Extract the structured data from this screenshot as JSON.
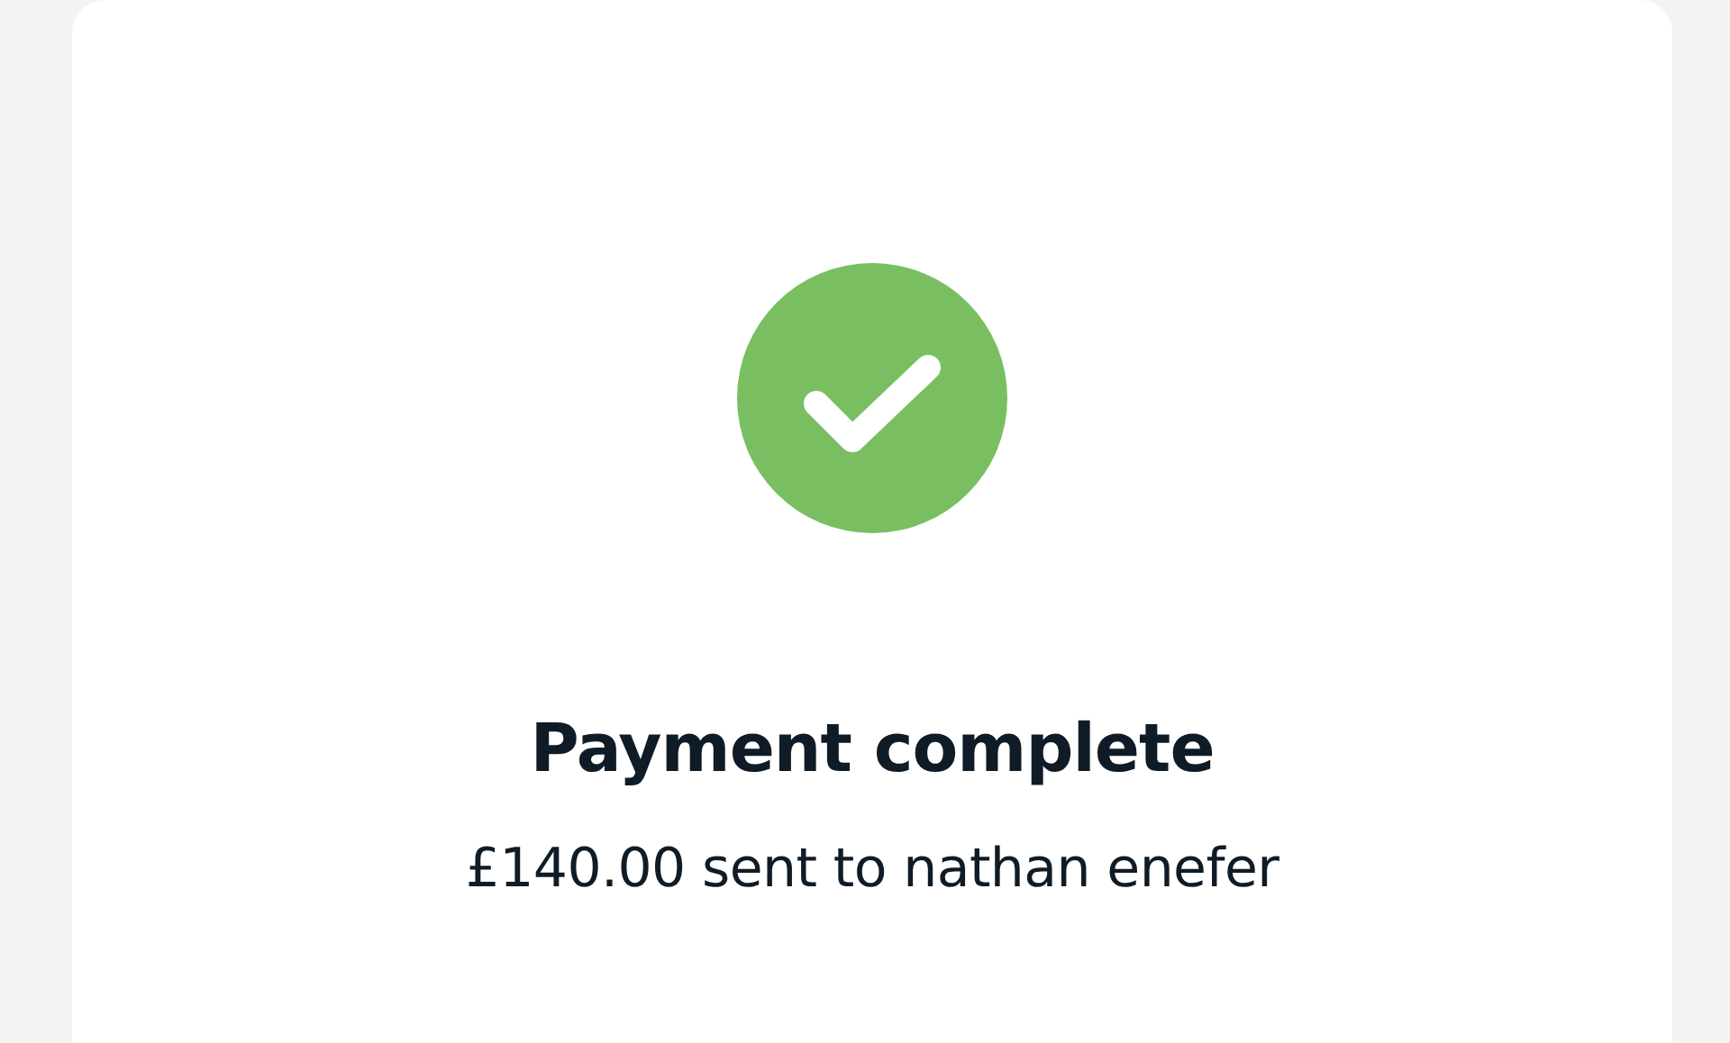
{
  "status": {
    "kind": "success"
  },
  "title": "Payment complete",
  "message": "£140.00 sent to nathan enefer"
}
